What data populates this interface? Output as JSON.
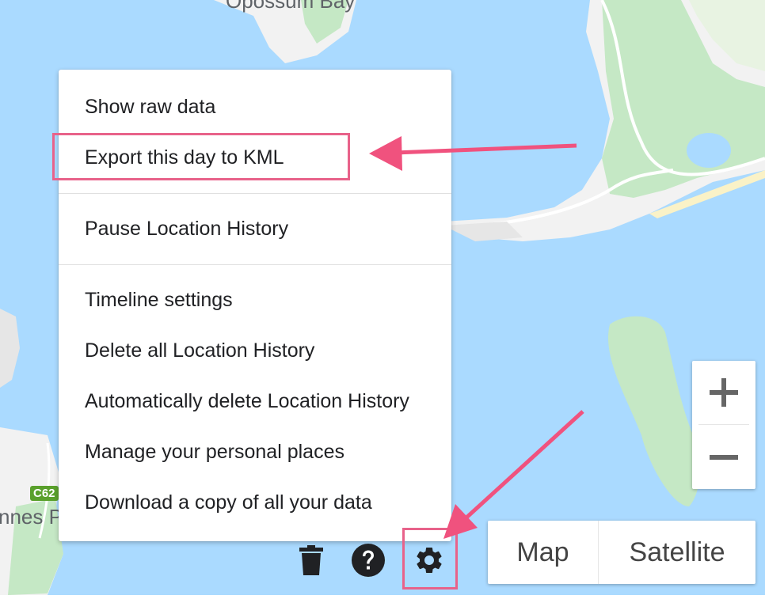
{
  "map": {
    "place_label_top": "Opossum Bay",
    "place_label_left": "nnes Po",
    "road_shield": "C62",
    "colors": {
      "water": "#aadaff",
      "land": "#f2f2f2",
      "park": "#c5e8c5",
      "sand": "#faf2c7",
      "road": "#ffffff"
    }
  },
  "menu": {
    "items": [
      {
        "label": "Show raw data"
      },
      {
        "label": "Export this day to KML"
      },
      {
        "label": "Pause Location History"
      },
      {
        "label": "Timeline settings"
      },
      {
        "label": "Delete all Location History"
      },
      {
        "label": "Automatically delete Location History"
      },
      {
        "label": "Manage your personal places"
      },
      {
        "label": "Download a copy of all your data"
      }
    ]
  },
  "toolbar": {
    "icons": [
      "trash-icon",
      "help-icon",
      "gear-icon"
    ]
  },
  "zoom": {
    "in_label": "+",
    "out_label": "−"
  },
  "map_type": {
    "map_label": "Map",
    "satellite_label": "Satellite"
  },
  "annotations": {
    "highlight_color": "#e8628a"
  }
}
